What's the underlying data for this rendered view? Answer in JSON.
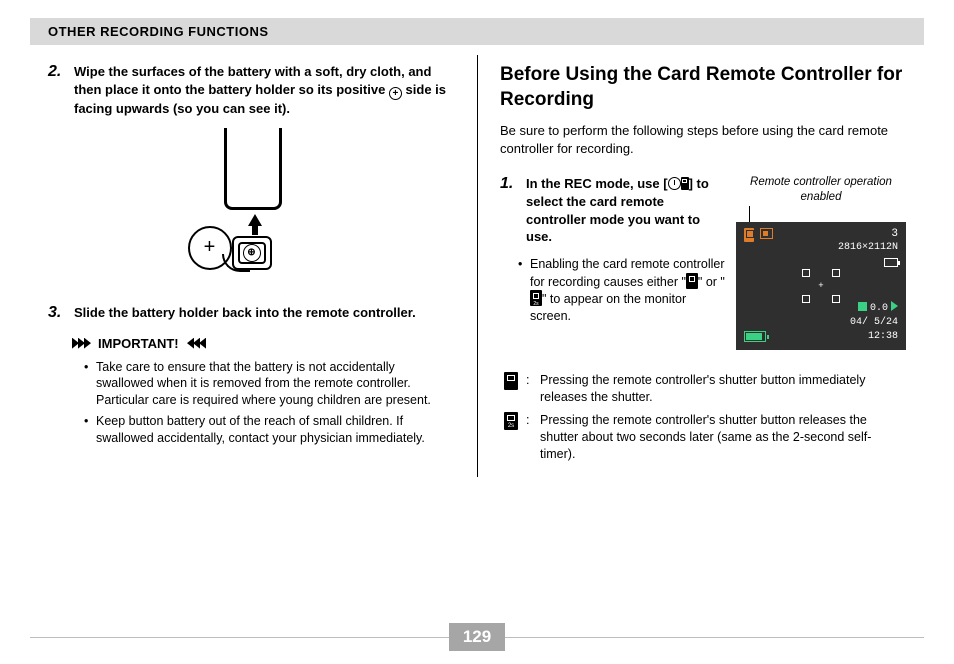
{
  "header": {
    "title": "OTHER RECORDING FUNCTIONS"
  },
  "left": {
    "step2": {
      "num": "2.",
      "text_pre": "Wipe the surfaces of the battery with a soft, dry cloth, and then place it onto the battery holder so its positive ",
      "text_post": " side is facing upwards (so you can see it)."
    },
    "step3": {
      "num": "3.",
      "text": "Slide the battery holder back into the remote controller."
    },
    "important_label": "IMPORTANT!",
    "important_items": [
      "Take care to ensure that the battery is not accidentally swallowed when it is removed from the remote controller. Particular care is required where young children are present.",
      "Keep button battery out of the reach of small children. If swallowed accidentally, contact your physician immediately."
    ]
  },
  "right": {
    "title": "Before Using the Card Remote Controller for Recording",
    "intro": "Be sure to perform the following steps before using the card remote controller for recording.",
    "step1": {
      "num": "1.",
      "line1_pre": "In the REC mode, use [",
      "line1_post": "] to select the card remote controller mode you want to use."
    },
    "sub_bullet_pre": "Enabling the card remote controller for recording causes either \"",
    "sub_bullet_mid": "\" or \"",
    "sub_bullet_post": "\" to appear on the monitor screen.",
    "figure_caption": "Remote controller operation enabled",
    "camera": {
      "count": "3",
      "resolution": "2816×2112N",
      "ev": "0.0",
      "date": "04/ 5/24",
      "time": "12:38"
    },
    "legend": [
      "Pressing the remote controller's shutter button immediately releases the shutter.",
      "Pressing the remote controller's shutter button releases the shutter about two seconds later (same as the 2-second self-timer)."
    ]
  },
  "page_number": "129"
}
